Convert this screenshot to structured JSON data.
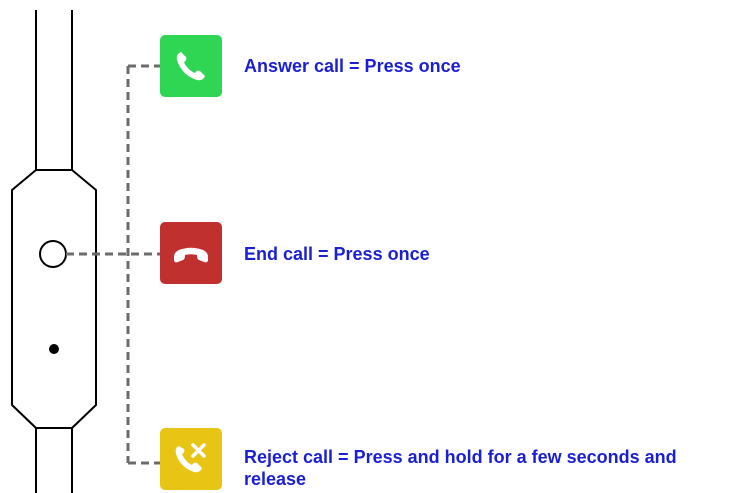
{
  "colors": {
    "answer": "#2fd653",
    "end": "#c0302e",
    "reject": "#e8c414",
    "label_text": "#1a1fd4",
    "line": "#000000",
    "dashed": "#6b6b6b"
  },
  "actions": [
    {
      "icon": "phone-answer-icon",
      "label": "Answer call = Press once"
    },
    {
      "icon": "phone-hangup-icon",
      "label": "End call = Press once"
    },
    {
      "icon": "phone-reject-icon",
      "label": "Reject call = Press and hold for a few seconds and release"
    }
  ]
}
